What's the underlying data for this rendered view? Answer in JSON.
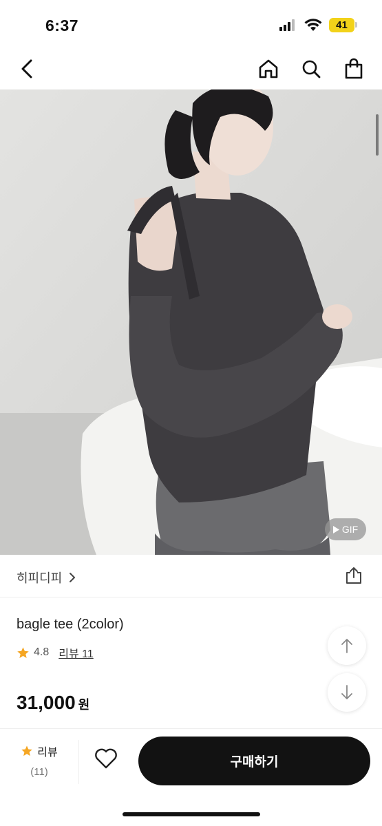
{
  "status_bar": {
    "time": "6:37",
    "battery": "41"
  },
  "nav": {
    "back_icon": "chevron-left-icon",
    "home_icon": "home-icon",
    "search_icon": "search-icon",
    "cart_icon": "shopping-bag-icon"
  },
  "hero": {
    "badge": "GIF"
  },
  "brand": {
    "name": "히피디피"
  },
  "product": {
    "title": "bagle tee (2color)",
    "rating": "4.8",
    "review_label": "리뷰 11",
    "price": "31,000",
    "currency": "원"
  },
  "bottom_bar": {
    "review_label": "리뷰",
    "review_count": "(11)",
    "buy_label": "구매하기"
  },
  "colors": {
    "accent_star": "#f5a623",
    "buy_button": "#121212",
    "battery": "#f2d21a"
  }
}
